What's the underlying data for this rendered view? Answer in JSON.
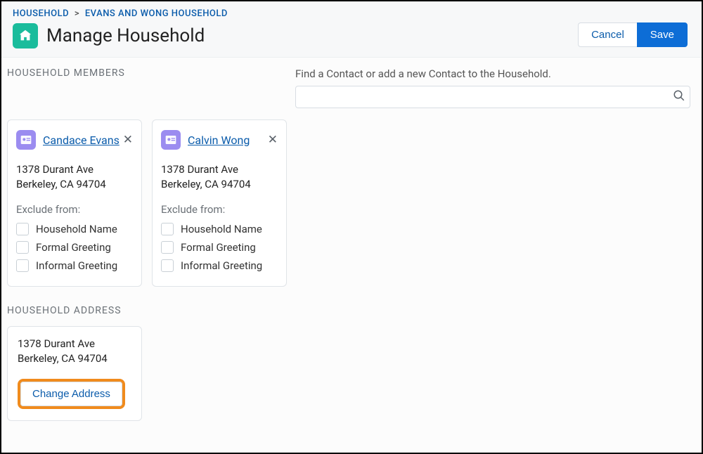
{
  "breadcrumb": {
    "root": "HOUSEHOLD",
    "sep": ">",
    "current": "EVANS AND WONG HOUSEHOLD"
  },
  "page_title": "Manage Household",
  "actions": {
    "cancel": "Cancel",
    "save": "Save"
  },
  "sections": {
    "members": "HOUSEHOLD MEMBERS",
    "address": "HOUSEHOLD ADDRESS"
  },
  "search": {
    "label": "Find a Contact or add a new Contact to the Household.",
    "value": ""
  },
  "members": [
    {
      "name": "Candace Evans",
      "address_line1": "1378 Durant Ave",
      "address_line2": "Berkeley, CA 94704",
      "exclude_label": "Exclude from:",
      "options": {
        "household_name": "Household Name",
        "formal_greeting": "Formal Greeting",
        "informal_greeting": "Informal Greeting"
      }
    },
    {
      "name": "Calvin Wong",
      "address_line1": "1378 Durant Ave",
      "address_line2": "Berkeley, CA 94704",
      "exclude_label": "Exclude from:",
      "options": {
        "household_name": "Household Name",
        "formal_greeting": "Formal Greeting",
        "informal_greeting": "Informal Greeting"
      }
    }
  ],
  "household_address": {
    "line1": "1378 Durant Ave",
    "line2": "Berkeley, CA 94704",
    "change_button": "Change Address"
  }
}
